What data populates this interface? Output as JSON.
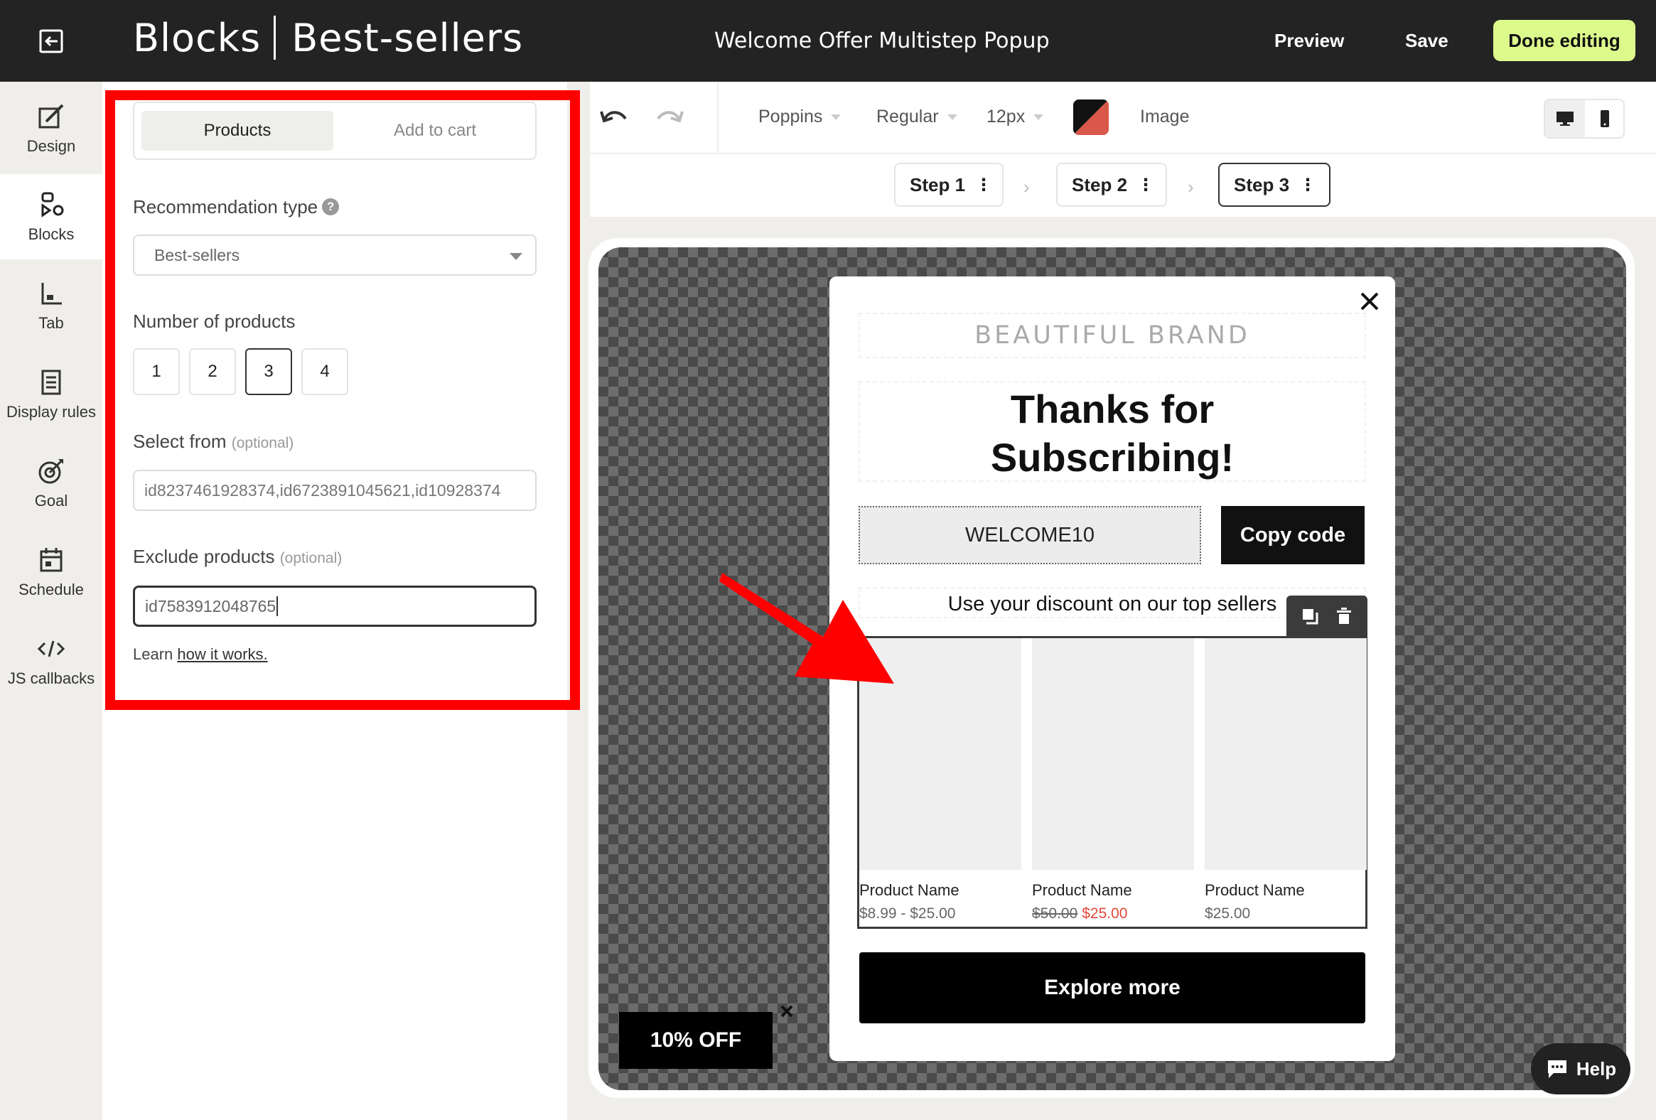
{
  "header": {
    "title_primary": "Blocks",
    "title_secondary": "Best-sellers",
    "campaign_name": "Welcome Offer Multistep Popup",
    "preview_label": "Preview",
    "save_label": "Save",
    "done_label": "Done editing",
    "done_color": "#dcfa8c"
  },
  "nav": {
    "items": [
      {
        "label": "Design",
        "icon": "design-icon"
      },
      {
        "label": "Blocks",
        "icon": "blocks-icon",
        "active": true
      },
      {
        "label": "Tab",
        "icon": "tab-icon"
      },
      {
        "label": "Display rules",
        "icon": "display-rules-icon"
      },
      {
        "label": "Goal",
        "icon": "goal-icon"
      },
      {
        "label": "Schedule",
        "icon": "schedule-icon"
      },
      {
        "label": "JS callbacks",
        "icon": "code-icon"
      }
    ]
  },
  "panel": {
    "tabs": [
      "Products",
      "Add to cart"
    ],
    "active_tab": "Products",
    "recommendation_label": "Recommendation type",
    "recommendation_value": "Best-sellers",
    "count_label": "Number of products",
    "count_options": [
      "1",
      "2",
      "3",
      "4"
    ],
    "count_selected": "3",
    "select_from_label": "Select from",
    "optional_note": "(optional)",
    "select_from_value": "id8237461928374,id6723891045621,id10928374",
    "exclude_label": "Exclude products",
    "exclude_value": "id7583912048765",
    "learn_prefix": "Learn",
    "learn_link": "how it works."
  },
  "toolbar": {
    "font_family": "Poppins",
    "font_weight": "Regular",
    "font_size": "12px",
    "image_label": "Image",
    "swatch_colors": [
      "#111111",
      "#d9574b"
    ]
  },
  "steps": [
    {
      "label": "Step 1",
      "current": false
    },
    {
      "label": "Step 2",
      "current": false
    },
    {
      "label": "Step 3",
      "current": true
    }
  ],
  "popup": {
    "brand": "BEAUTIFUL BRAND",
    "headline_line1": "Thanks for",
    "headline_line2": "Subscribing!",
    "discount_code": "WELCOME10",
    "copy_label": "Copy code",
    "subtext": "Use your discount on our top sellers",
    "products": [
      {
        "name": "Product Name",
        "price": "$8.99 - $25.00",
        "old_price": "",
        "sale_price": ""
      },
      {
        "name": "Product Name",
        "price": "",
        "old_price": "$50.00",
        "sale_price": "$25.00"
      },
      {
        "name": "Product Name",
        "price": "$25.00",
        "old_price": "",
        "sale_price": ""
      }
    ],
    "explore_label": "Explore more"
  },
  "teaser": {
    "label": "10% OFF"
  },
  "help": {
    "label": "Help"
  }
}
